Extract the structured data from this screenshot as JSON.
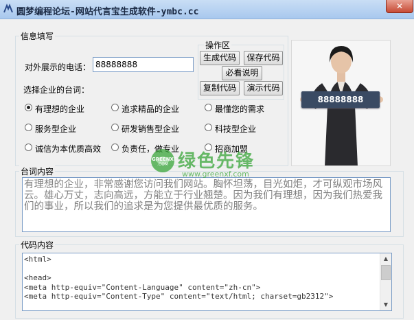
{
  "window": {
    "title": "圆梦编程论坛-网站代言宝生成软件-ymbc.cc",
    "close_label": "✕"
  },
  "info_group": {
    "legend": "信息填写",
    "phone_label": "对外展示的电话：",
    "phone_value": "88888888",
    "slogan_label": "选择企业的台词："
  },
  "radios": [
    {
      "label": "有理想的企业",
      "selected": true
    },
    {
      "label": "追求精品的企业",
      "selected": false
    },
    {
      "label": "最懂您的需求",
      "selected": false
    },
    {
      "label": "服务型企业",
      "selected": false
    },
    {
      "label": "研发销售型企业",
      "selected": false
    },
    {
      "label": "科技型企业",
      "selected": false
    },
    {
      "label": "诚信为本优质高效",
      "selected": false
    },
    {
      "label": "负责任，做专业",
      "selected": false
    },
    {
      "label": "招商加盟",
      "selected": false
    }
  ],
  "ops_group": {
    "legend": "操作区",
    "generate": "生成代码",
    "save": "保存代码",
    "help": "必看说明",
    "copy": "复制代码",
    "demo": "演示代码"
  },
  "preview": {
    "phone_display": "88888888"
  },
  "intro_group": {
    "legend": "台词内容",
    "text": "有理想的企业，非常感谢您访问我们网站。胸怀坦荡，目光如炬，才可纵观市场风云。雄心万丈，志向高远，方能立于行业翘楚。因为我们有理想，因为我们热爱我们的事业，所以我们的追求是为您提供最优质的服务。"
  },
  "code_group": {
    "legend": "代码内容",
    "text": "<html>\n\n<head>\n<meta http-equiv=\"Content-Language\" content=\"zh-cn\">\n<meta http-equiv=\"Content-Type\" content=\"text/html; charset=gb2312\">"
  },
  "watermark": {
    "brand": "绿色先锋",
    "badge": "GREENXF",
    "badge_sub": ".COM",
    "url": "www.greenxf.com"
  },
  "colors": {
    "title_bar": "#a8c8ee",
    "input_border": "#7a9cc6",
    "watermark_green": "#3aa63a"
  }
}
